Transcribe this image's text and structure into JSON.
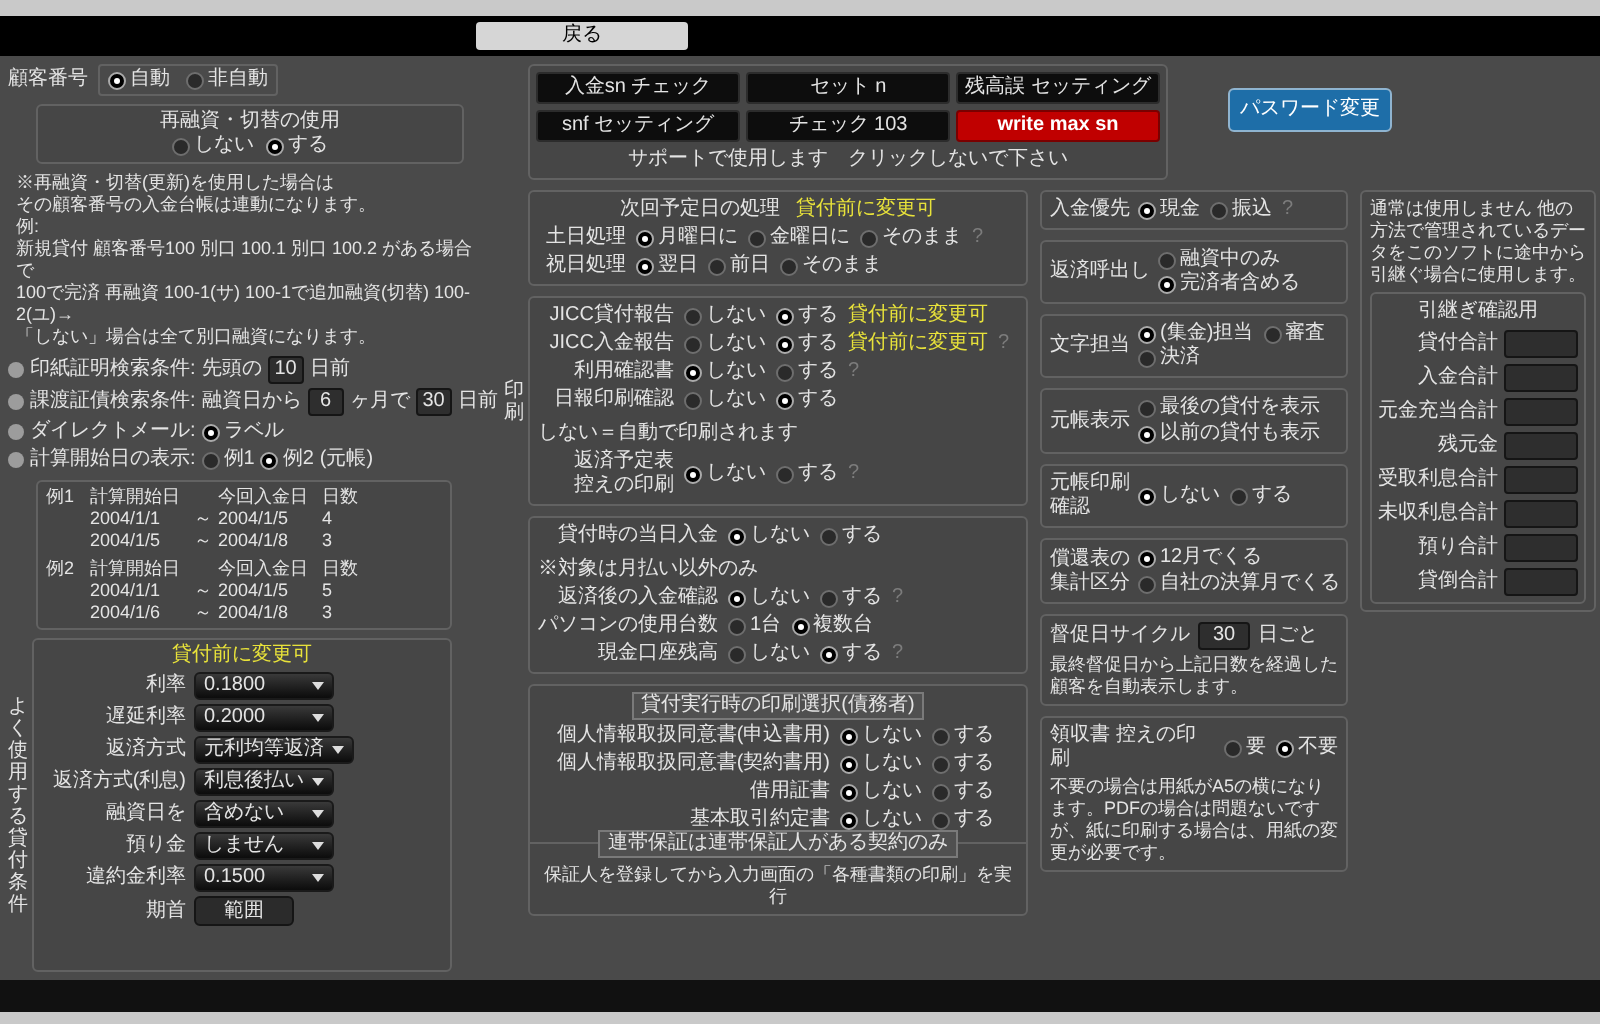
{
  "back_button": "戻る",
  "customer_number": {
    "label": "顧客番号",
    "options": [
      {
        "label": "自動",
        "selected": true
      },
      {
        "label": "非自動",
        "selected": false
      }
    ]
  },
  "refinance": {
    "title": "再融資・切替の使用",
    "options": [
      {
        "label": "しない",
        "selected": false
      },
      {
        "label": "する",
        "selected": true
      }
    ]
  },
  "notes": [
    "※再融資・切替(更新)を使用した場合は",
    "その顧客番号の入金台帳は連動になります。",
    "例:",
    "新規貸付 顧客番号100 別口 100.1 別口 100.2 がある場合で",
    "100で完済 再融資 100-1(サ) 100-1で追加融資(切替) 100-2(ユ)→",
    "「しない」場合は全て別口融資になります。"
  ],
  "search_options": [
    {
      "label": "印紙証明検索条件:",
      "parts": [
        {
          "kind": "text",
          "text": "先頭の"
        },
        {
          "kind": "field",
          "value": "10"
        },
        {
          "kind": "text",
          "text": "日前"
        }
      ]
    },
    {
      "label": "課渡証債検索条件:",
      "parts": [
        {
          "kind": "text",
          "text": "融資日から"
        },
        {
          "kind": "field",
          "value": "6"
        },
        {
          "kind": "text",
          "text": "ヶ月で"
        },
        {
          "kind": "field",
          "value": "30"
        },
        {
          "kind": "text",
          "text": "日前"
        }
      ]
    },
    {
      "label": "ダイレクトメール:",
      "parts": [
        {
          "kind": "radio",
          "label": "ラベル",
          "selected": true
        }
      ]
    },
    {
      "label": "計算開始日の表示:",
      "parts": [
        {
          "kind": "radio",
          "label": "例1",
          "selected": false
        },
        {
          "kind": "radio",
          "label": "例2",
          "selected": true
        },
        {
          "kind": "note",
          "text": "(元帳)",
          "highlight": false
        }
      ]
    }
  ],
  "examples": [
    {
      "header": [
        "例1",
        "計算開始日",
        "今回入金日",
        "日数"
      ],
      "rows": [
        [
          "2004/1/1",
          "～",
          "2004/1/5",
          "4"
        ],
        [
          "2004/1/5",
          "～",
          "2004/1/8",
          "3"
        ]
      ]
    },
    {
      "header": [
        "例2",
        "計算開始日",
        "今回入金日",
        "日数"
      ],
      "rows": [
        [
          "2004/1/1",
          "～",
          "2004/1/5",
          "5"
        ],
        [
          "2004/1/6",
          "～",
          "2004/1/8",
          "3"
        ]
      ]
    }
  ],
  "loan_conditions": {
    "side_label": "よく使用する貸付条件",
    "title": "貸付前に変更可",
    "rows": [
      {
        "kind": "select",
        "label": "利率",
        "value": "0.1800"
      },
      {
        "kind": "select",
        "label": "遅延利率",
        "value": "0.2000"
      },
      {
        "kind": "select",
        "label": "返済方式",
        "value": "元利均等返済"
      },
      {
        "kind": "select",
        "label": "返済方式(利息)",
        "value": "利息後払い"
      },
      {
        "kind": "select",
        "label": "融資日を",
        "value": "含めない"
      },
      {
        "kind": "select",
        "label": "預り金",
        "value": "しません"
      },
      {
        "kind": "select",
        "label": "違約金利率",
        "value": "0.1500"
      },
      {
        "kind": "button",
        "label": "期首",
        "value": "範囲"
      }
    ]
  },
  "support_tools": {
    "buttons": [
      {
        "label": "入金sn チェック",
        "kind": "normal"
      },
      {
        "label": "セット n",
        "kind": "normal"
      },
      {
        "label": "残高誤 セッティング",
        "kind": "normal"
      },
      {
        "label": "snf セッティング",
        "kind": "normal"
      },
      {
        "label": "チェック 103",
        "kind": "normal"
      },
      {
        "label": "write max sn",
        "kind": "danger"
      }
    ],
    "caption": "サポートで使用します　クリックしないで下さい"
  },
  "password_button": "パスワード変更",
  "schedule": {
    "title": "次回予定日の処理",
    "note": "貸付前に変更可",
    "rows": [
      {
        "label": [
          "土日処理"
        ],
        "parts": [
          {
            "kind": "radio",
            "label": "月曜日に",
            "selected": true
          },
          {
            "kind": "radio",
            "label": "金曜日に",
            "selected": false
          },
          {
            "kind": "radio",
            "label": "そのまま",
            "selected": false
          },
          {
            "kind": "help",
            "text": "?"
          }
        ]
      },
      {
        "label": [
          "祝日処理"
        ],
        "parts": [
          {
            "kind": "radio",
            "label": "翌日",
            "selected": true
          },
          {
            "kind": "radio",
            "label": "前日",
            "selected": false
          },
          {
            "kind": "radio",
            "label": "そのまま",
            "selected": false
          }
        ]
      }
    ]
  },
  "print_side_label": "印刷",
  "reports": [
    {
      "label": [
        "JICC貸付報告"
      ],
      "parts": [
        {
          "kind": "radio",
          "label": "しない",
          "selected": false
        },
        {
          "kind": "radio",
          "label": "する",
          "selected": true
        },
        {
          "kind": "note",
          "text": "貸付前に変更可",
          "highlight": true
        }
      ]
    },
    {
      "label": [
        "JICC入金報告"
      ],
      "parts": [
        {
          "kind": "radio",
          "label": "しない",
          "selected": false
        },
        {
          "kind": "radio",
          "label": "する",
          "selected": true
        },
        {
          "kind": "note",
          "text": "貸付前に変更可",
          "highlight": true
        },
        {
          "kind": "help",
          "text": "?"
        }
      ]
    },
    {
      "label": [
        "利用確認書"
      ],
      "parts": [
        {
          "kind": "radio",
          "label": "しない",
          "selected": true
        },
        {
          "kind": "radio",
          "label": "する",
          "selected": false
        },
        {
          "kind": "help",
          "text": "?"
        }
      ]
    },
    {
      "label": [
        "日報印刷確認"
      ],
      "parts": [
        {
          "kind": "radio",
          "label": "しない",
          "selected": false
        },
        {
          "kind": "radio",
          "label": "する",
          "selected": true
        },
        {
          "kind": "note",
          "text": "しない＝自動で印刷されます",
          "highlight": false
        }
      ]
    },
    {
      "label": [
        "返済予定表",
        "控えの印刷"
      ],
      "parts": [
        {
          "kind": "radio",
          "label": "しない",
          "selected": true
        },
        {
          "kind": "radio",
          "label": "する",
          "selected": false
        },
        {
          "kind": "help",
          "text": "?"
        }
      ]
    }
  ],
  "payments": [
    {
      "label": [
        "貸付時の当日入金"
      ],
      "parts": [
        {
          "kind": "radio",
          "label": "しない",
          "selected": true
        },
        {
          "kind": "radio",
          "label": "する",
          "selected": false
        },
        {
          "kind": "note",
          "text": "※対象は月払い以外のみ",
          "highlight": false
        }
      ]
    },
    {
      "label": [
        "返済後の入金確認"
      ],
      "parts": [
        {
          "kind": "radio",
          "label": "しない",
          "selected": true
        },
        {
          "kind": "radio",
          "label": "する",
          "selected": false
        },
        {
          "kind": "help",
          "text": "?"
        }
      ]
    },
    {
      "label": [
        "パソコンの使用台数"
      ],
      "parts": [
        {
          "kind": "radio",
          "label": "1台",
          "selected": false
        },
        {
          "kind": "radio",
          "label": "複数台",
          "selected": true
        }
      ]
    },
    {
      "label": [
        "現金口座残高"
      ],
      "parts": [
        {
          "kind": "radio",
          "label": "しない",
          "selected": false
        },
        {
          "kind": "radio",
          "label": "する",
          "selected": true
        },
        {
          "kind": "help",
          "text": "?"
        }
      ]
    }
  ],
  "print_selection": {
    "title": "貸付実行時の印刷選択(債務者)",
    "rows": [
      {
        "label": [
          "個人情報取扱同意書(申込書用)"
        ],
        "parts": [
          {
            "kind": "radio",
            "label": "しない",
            "selected": true
          },
          {
            "kind": "radio",
            "label": "する",
            "selected": false
          }
        ]
      },
      {
        "label": [
          "個人情報取扱同意書(契約書用)"
        ],
        "parts": [
          {
            "kind": "radio",
            "label": "しない",
            "selected": true
          },
          {
            "kind": "radio",
            "label": "する",
            "selected": false
          }
        ]
      },
      {
        "label": [
          "借用証書"
        ],
        "parts": [
          {
            "kind": "radio",
            "label": "しない",
            "selected": true
          },
          {
            "kind": "radio",
            "label": "する",
            "selected": false
          }
        ]
      },
      {
        "label": [
          "基本取引約定書"
        ],
        "parts": [
          {
            "kind": "radio",
            "label": "しない",
            "selected": true
          },
          {
            "kind": "radio",
            "label": "する",
            "selected": false
          }
        ]
      }
    ],
    "guarantor_title": "連帯保証は連帯保証人がある契約のみ",
    "guarantor_text": "保証人を登録してから入力画面の「各種書類の印刷」を実行"
  },
  "display_settings": [
    {
      "kind": "inline",
      "label": [
        "入金優先"
      ],
      "parts": [
        {
          "kind": "radio",
          "label": "現金",
          "selected": true
        },
        {
          "kind": "radio",
          "label": "振込",
          "selected": false
        },
        {
          "kind": "help",
          "text": "?"
        }
      ]
    },
    {
      "kind": "inline",
      "label": [
        "返済呼出し"
      ],
      "parts": [
        {
          "kind": "radio",
          "label": "融資中のみ",
          "selected": false
        },
        {
          "kind": "radio",
          "label": "完済者含める",
          "selected": true
        }
      ]
    },
    {
      "kind": "inline",
      "label": [
        "文字担当"
      ],
      "parts": [
        {
          "kind": "radio",
          "label": "(集金)担当",
          "selected": true
        },
        {
          "kind": "radio",
          "label": "審査",
          "selected": false
        },
        {
          "kind": "radio",
          "label": "決済",
          "selected": false
        }
      ]
    },
    {
      "kind": "stacked",
      "label": [
        "元帳表示"
      ],
      "parts": [
        {
          "kind": "radio",
          "label": "最後の貸付を表示",
          "selected": false
        },
        {
          "kind": "radio",
          "label": "以前の貸付も表示",
          "selected": true
        }
      ]
    },
    {
      "kind": "inline",
      "label": [
        "元帳印刷",
        "確認"
      ],
      "parts": [
        {
          "kind": "radio",
          "label": "しない",
          "selected": true
        },
        {
          "kind": "radio",
          "label": "する",
          "selected": false
        }
      ]
    },
    {
      "kind": "stacked",
      "label": [
        "償還表の",
        "集計区分"
      ],
      "parts": [
        {
          "kind": "radio",
          "label": "12月でくる",
          "selected": true
        },
        {
          "kind": "radio",
          "label": "自社の決算月でくる",
          "selected": false
        }
      ]
    }
  ],
  "reminder_cycle": {
    "label": "督促日サイクル",
    "value": "30",
    "suffix": "日ごと",
    "text": "最終督促日から上記日数を経過した顧客を自動表示します。"
  },
  "receipt": {
    "label": "領収書 控えの印刷",
    "options": [
      {
        "label": "要",
        "selected": false
      },
      {
        "label": "不要",
        "selected": true
      }
    ],
    "text": "不要の場合は用紙がA5の横になります。PDFの場合は問題ないですが、紙に印刷する場合は、用紙の変更が必要です。"
  },
  "carryover": {
    "text": "通常は使用しません 他の方法で管理されているデータをこのソフトに途中から引継ぐ場合に使用します。",
    "title": "引継ぎ確認用",
    "fields": [
      {
        "label": "貸付合計"
      },
      {
        "label": "入金合計"
      },
      {
        "label": "元金充当合計"
      },
      {
        "label": "残元金"
      },
      {
        "label": "受取利息合計"
      },
      {
        "label": "未収利息合計"
      },
      {
        "label": "預り合計"
      },
      {
        "label": "貸倒合計"
      }
    ]
  }
}
